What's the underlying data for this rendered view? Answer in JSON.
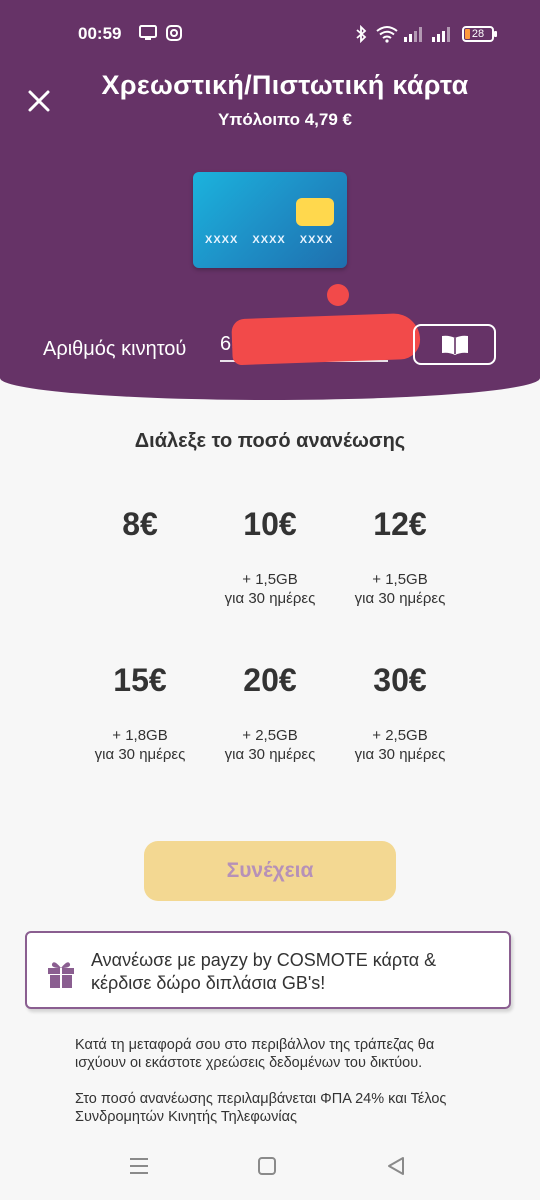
{
  "status_bar": {
    "time": "00:59",
    "battery": "28",
    "icons": [
      "screen-cast-icon",
      "instagram-icon",
      "bluetooth-icon",
      "wifi-icon",
      "signal-icon",
      "signal-icon",
      "battery-icon"
    ]
  },
  "header": {
    "title": "Χρεωστική/Πιστωτική κάρτα",
    "balance": "Υπόλοιπο 4,79 €",
    "close_icon": "close-icon"
  },
  "card": {
    "number_mask": "XXXX XXXX XXXX"
  },
  "phone": {
    "label": "Αριθμός κινητού",
    "value": "69",
    "contacts_icon": "book-icon"
  },
  "amounts": {
    "heading": "Διάλεξε το ποσό ανανέωσης",
    "items": [
      {
        "price": "8€",
        "bonus": "",
        "duration": ""
      },
      {
        "price": "10€",
        "bonus": "+ 1,5GB",
        "duration": "για 30 ημέρες"
      },
      {
        "price": "12€",
        "bonus": "+ 1,5GB",
        "duration": "για 30 ημέρες"
      },
      {
        "price": "15€",
        "bonus": "+ 1,8GB",
        "duration": "για 30 ημέρες"
      },
      {
        "price": "20€",
        "bonus": "+ 2,5GB",
        "duration": "για 30 ημέρες"
      },
      {
        "price": "30€",
        "bonus": "+ 2,5GB",
        "duration": "για 30 ημέρες"
      }
    ]
  },
  "continue_button": "Συνέχεια",
  "promo": {
    "text": "Ανανέωσε με payzy by COSMOTE κάρτα & κέρδισε δώρο διπλάσια GB's!",
    "icon": "gift-icon"
  },
  "info": {
    "paragraph1": "Κατά τη μεταφορά σου στο περιβάλλον της τράπεζας θα ισχύουν οι εκάστοτε χρεώσεις δεδομένων του δικτύου.",
    "paragraph2": "Στο ποσό ανανέωσης περιλαμβάνεται ΦΠΑ 24% και Τέλος Συνδρομητών Κινητής Τηλεφωνίας"
  },
  "colors": {
    "header_bg": "#663367",
    "continue_disabled_bg": "#f3d892",
    "continue_disabled_text": "#b691b8",
    "promo_border": "#8a5e90",
    "redaction": "#f24a4a"
  }
}
